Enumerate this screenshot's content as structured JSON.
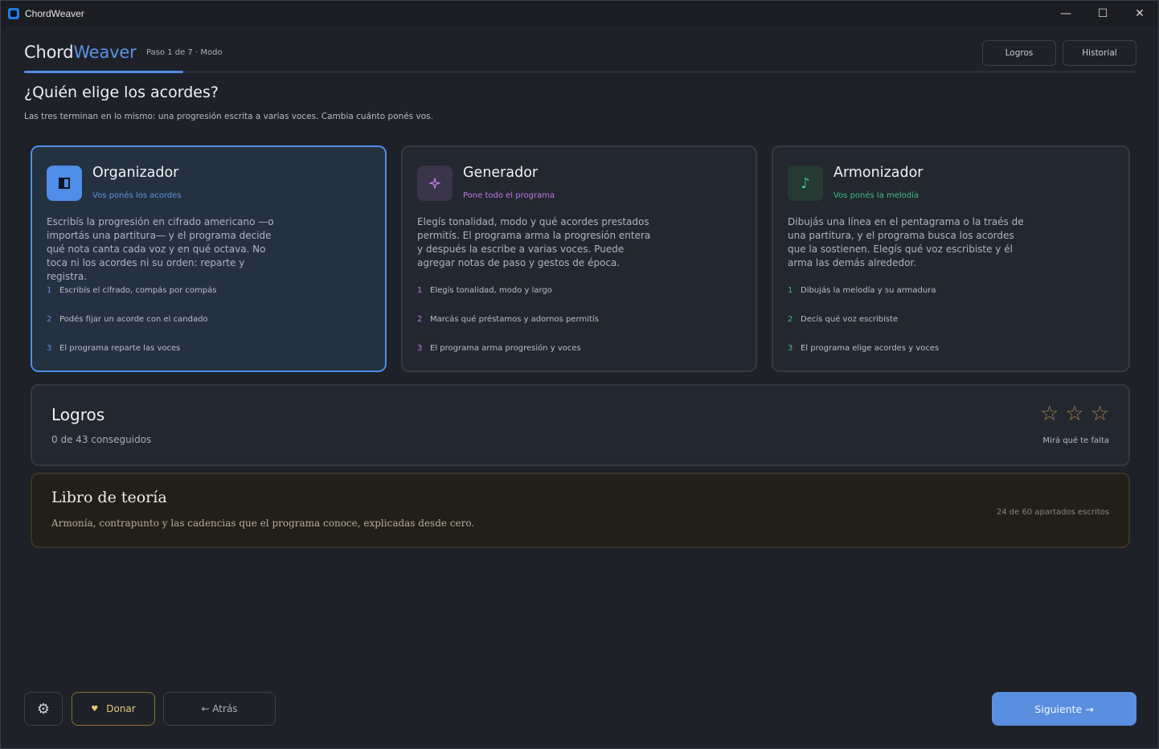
{
  "window": {
    "title": "ChordWeaver",
    "minimize": "—",
    "maximize": "☐",
    "close": "✕"
  },
  "header": {
    "logo_a": "Chord",
    "logo_b": "Weaver",
    "step": "Paso 1 de 7 · Modo",
    "progress_fraction": 0.143,
    "buttons": {
      "achievements": "Logros",
      "history": "Historial"
    }
  },
  "question": {
    "title": "¿Quién elige los acordes?",
    "subtitle": "Las tres terminan en lo mismo: una progresión escrita a varias voces. Cambia cuánto ponés vos."
  },
  "modes": [
    {
      "name": "Organizador",
      "tag": "Vos ponés los acordes",
      "icon": "panel-icon",
      "color": "#5b93e6",
      "selected": true,
      "description": "Escribís la progresión en cifrado americano —o importás una partitura— y el programa decide qué nota canta cada voz y en qué octava. No toca ni los acordes ni su orden: reparte y registra.",
      "steps": [
        {
          "n": "1",
          "text": "Escribís el cifrado, compás por compás"
        },
        {
          "n": "2",
          "text": "Podés fijar un acorde con el candado"
        },
        {
          "n": "3",
          "text": "El programa reparte las voces"
        }
      ]
    },
    {
      "name": "Generador",
      "tag": "Pone todo el programa",
      "icon": "sparkle-icon",
      "color": "#c27ae6",
      "selected": false,
      "description": "Elegís tonalidad, modo y qué acordes prestados permitís. El programa arma la progresión entera y después la escribe a varias voces. Puede agregar notas de paso y gestos de época.",
      "steps": [
        {
          "n": "1",
          "text": "Elegís tonalidad, modo y largo"
        },
        {
          "n": "2",
          "text": "Marcás qué préstamos y adornos permitís"
        },
        {
          "n": "3",
          "text": "El programa arma progresión y voces"
        }
      ]
    },
    {
      "name": "Armonizador",
      "tag": "Vos ponés la melodía",
      "icon": "music-note-icon",
      "color": "#3fbf86",
      "selected": false,
      "description": "Dibujás una línea en el pentagrama o la traés de una partitura, y el programa busca los acordes que la sostienen. Elegís qué voz escribiste y él arma las demás alrededor.",
      "steps": [
        {
          "n": "1",
          "text": "Dibujás la melodía y su armadura"
        },
        {
          "n": "2",
          "text": "Decís qué voz escribiste"
        },
        {
          "n": "3",
          "text": "El programa elige acordes y voces"
        }
      ]
    }
  ],
  "achievements": {
    "title": "Logros",
    "count": "0 de 43 conseguidos",
    "stars": [
      "☆",
      "☆",
      "☆"
    ],
    "caption": "Mirá qué te falta"
  },
  "theory_book": {
    "title": "Libro de teoría",
    "description": "Armonía, contrapunto y las cadencias que el programa conoce, explicadas desde cero.",
    "count": "24 de 60 apartados escritos"
  },
  "footer": {
    "settings_icon": "⚙",
    "donate_icon": "♥",
    "donate": "Donar",
    "back": "← Atrás",
    "next": "Siguiente →"
  }
}
